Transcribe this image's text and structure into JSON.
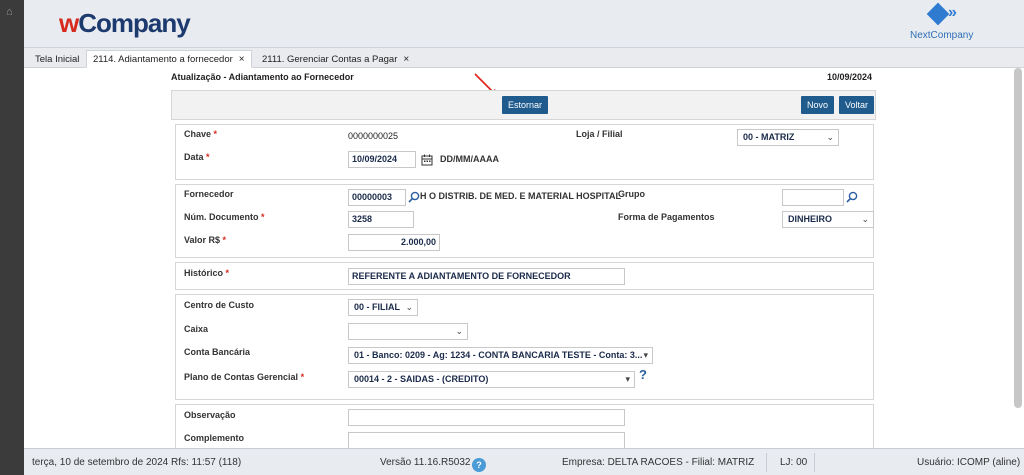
{
  "header": {
    "logo_w": "w",
    "logo_company": "Company",
    "brand_right": "NextCompany",
    "brand_right_mark": "»"
  },
  "tabs": [
    {
      "label": "Tela Inicial"
    },
    {
      "label": "2114. Adiantamento a fornecedor",
      "close": "×"
    },
    {
      "label": "2111. Gerenciar Contas a Pagar",
      "close": "×"
    }
  ],
  "form": {
    "title": "Atualização - Adiantamento ao Fornecedor",
    "date": "10/09/2024",
    "buttons": {
      "estornar": "Estornar",
      "novo": "Novo",
      "voltar": "Voltar"
    },
    "chave_label": "Chave",
    "chave_value": "0000000025",
    "loja_label": "Loja / Filial",
    "loja_value": "00 - MATRIZ",
    "data_label": "Data",
    "data_value": "10/09/2024",
    "data_format": "DD/MM/AAAA",
    "fornecedor_label": "Fornecedor",
    "fornecedor_code": "00000003",
    "fornecedor_name": "H O DISTRIB. DE MED. E MATERIAL HOSPITAL",
    "grupo_label": "Grupo",
    "grupo_value": "",
    "num_doc_label": "Núm. Documento",
    "num_doc_value": "3258",
    "forma_pag_label": "Forma de Pagamentos",
    "forma_pag_value": "DINHEIRO",
    "valor_label": "Valor R$",
    "valor_value": "2.000,00",
    "historico_label": "Histórico",
    "historico_value": "REFERENTE A ADIANTAMENTO DE FORNECEDOR",
    "centro_label": "Centro de Custo",
    "centro_value": "00 - FILIAL",
    "caixa_label": "Caixa",
    "caixa_value": "",
    "conta_label": "Conta Bancária",
    "conta_value": "01 - Banco: 0209 - Ag: 1234 - CONTA BANCARIA TESTE - Conta: 3...",
    "plano_label": "Plano de Contas Gerencial",
    "plano_value": "00014 - 2 - SAIDAS - (CREDITO)",
    "obs_label": "Observação",
    "obs_value": "",
    "compl_label": "Complemento",
    "compl_value": "",
    "required_mark": "*"
  },
  "status": {
    "datetime": "terça, 10 de setembro de 2024  Rfs: 11:57 (118)",
    "version": "Versão 11.16.R5032",
    "help": "?",
    "empresa": "Empresa: DELTA RACOES - Filial: MATRIZ",
    "lj": "LJ: 00",
    "usuario": "Usuário: ICOMP (aline)"
  },
  "colors": {
    "primary_button": "#1f5b8c",
    "brand_red": "#d62a1e",
    "brand_blue": "#1d3a6e",
    "accent": "#2f7bd0"
  },
  "icons": {
    "home": "home-icon",
    "search": "search-icon",
    "calendar": "calendar-icon",
    "help": "help-icon"
  }
}
